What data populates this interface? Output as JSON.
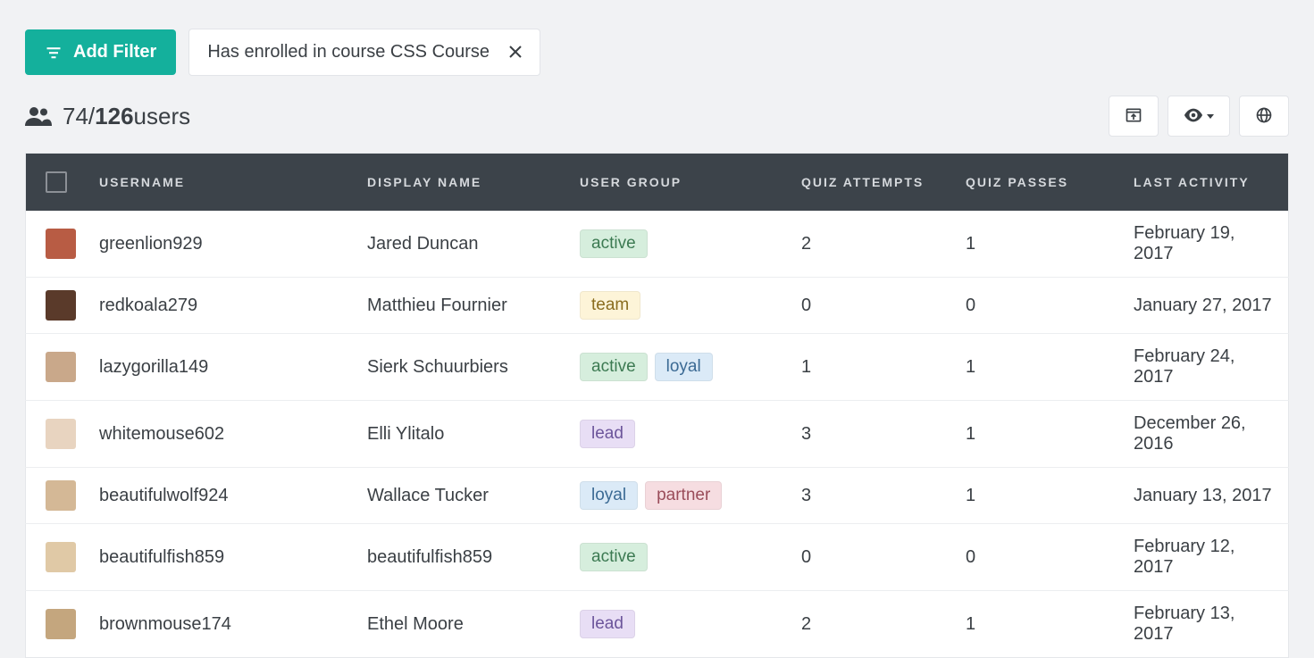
{
  "toolbar": {
    "add_filter_label": "Add Filter",
    "chip_text": "Has enrolled in course CSS Course"
  },
  "summary": {
    "filtered": "74",
    "separator": " / ",
    "total": "126",
    "suffix": " users"
  },
  "icons": {
    "filter": "filter-icon",
    "close": "close-icon",
    "people": "people-icon",
    "export": "open-in-browser-icon",
    "visibility": "eye-icon",
    "globe": "globe-icon"
  },
  "columns": {
    "username": "USERNAME",
    "display_name": "DISPLAY NAME",
    "user_group": "USER GROUP",
    "quiz_attempts": "QUIZ ATTEMPTS",
    "quiz_passes": "QUIZ PASSES",
    "last_activity": "LAST ACTIVITY"
  },
  "tag_labels": {
    "active": "active",
    "team": "team",
    "loyal": "loyal",
    "lead": "lead",
    "partner": "partner"
  },
  "avatar_colors": [
    "#b85c44",
    "#5a3a2a",
    "#c9a88a",
    "#e8d4c0",
    "#d4b896",
    "#e0c9a6",
    "#c4a67e"
  ],
  "rows": [
    {
      "username": "greenlion929",
      "display_name": "Jared Duncan",
      "groups": [
        "active"
      ],
      "attempts": "2",
      "passes": "1",
      "activity": "February 19, 2017"
    },
    {
      "username": "redkoala279",
      "display_name": "Matthieu Fournier",
      "groups": [
        "team"
      ],
      "attempts": "0",
      "passes": "0",
      "activity": "January 27, 2017"
    },
    {
      "username": "lazygorilla149",
      "display_name": "Sierk Schuurbiers",
      "groups": [
        "active",
        "loyal"
      ],
      "attempts": "1",
      "passes": "1",
      "activity": "February 24, 2017"
    },
    {
      "username": "whitemouse602",
      "display_name": "Elli Ylitalo",
      "groups": [
        "lead"
      ],
      "attempts": "3",
      "passes": "1",
      "activity": "December 26, 2016"
    },
    {
      "username": "beautifulwolf924",
      "display_name": "Wallace Tucker",
      "groups": [
        "loyal",
        "partner"
      ],
      "attempts": "3",
      "passes": "1",
      "activity": "January 13, 2017"
    },
    {
      "username": "beautifulfish859",
      "display_name": "beautifulfish859",
      "groups": [
        "active"
      ],
      "attempts": "0",
      "passes": "0",
      "activity": "February 12, 2017"
    },
    {
      "username": "brownmouse174",
      "display_name": "Ethel Moore",
      "groups": [
        "lead"
      ],
      "attempts": "2",
      "passes": "1",
      "activity": "February 13, 2017"
    }
  ]
}
